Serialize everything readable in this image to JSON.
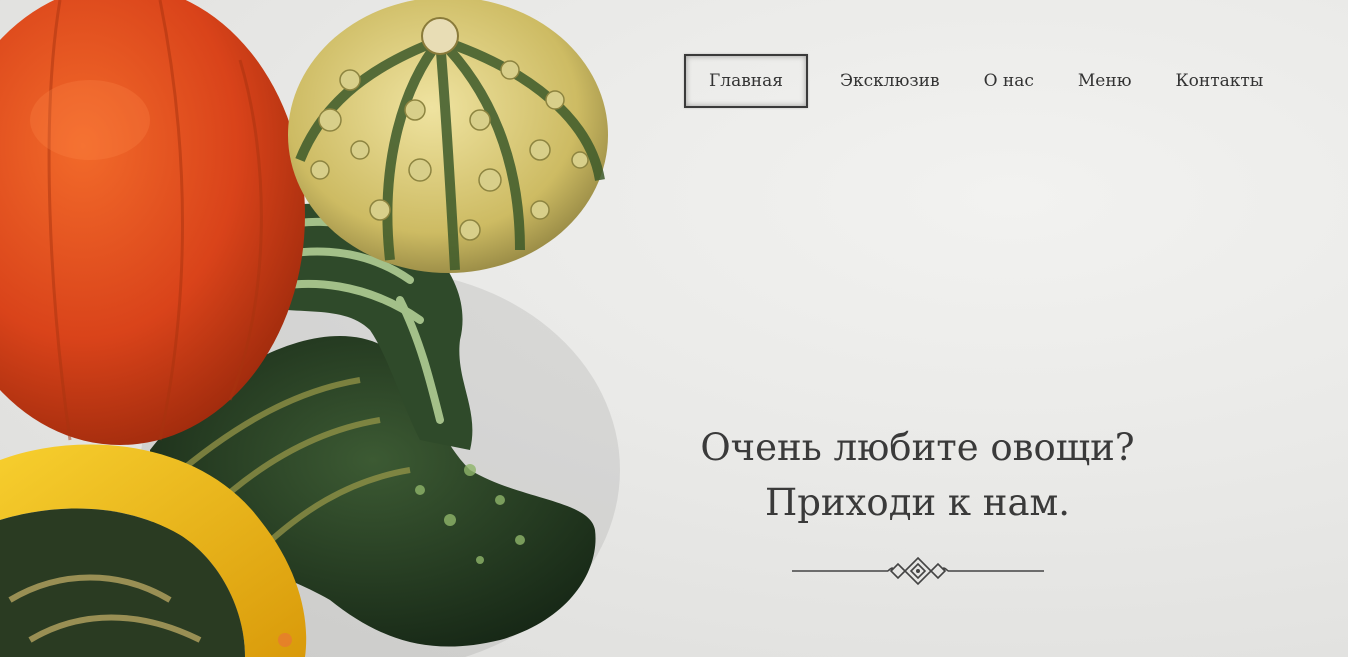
{
  "nav": {
    "items": [
      {
        "label": "Главная",
        "active": true
      },
      {
        "label": "Эксклюзив",
        "active": false
      },
      {
        "label": "О нас",
        "active": false
      },
      {
        "label": "Меню",
        "active": false
      },
      {
        "label": "Контакты",
        "active": false
      }
    ]
  },
  "hero": {
    "headline_line1": "Очень любите овощи?",
    "headline_line2": "Приходи к нам.",
    "image_subject": "pumpkins-and-gourds"
  },
  "colors": {
    "text": "#3a3a3a",
    "background": "#e9e9e7",
    "pumpkin": "#e0451a",
    "gourd_yellow": "#f2b915",
    "gourd_green": "#2f4a2a"
  }
}
